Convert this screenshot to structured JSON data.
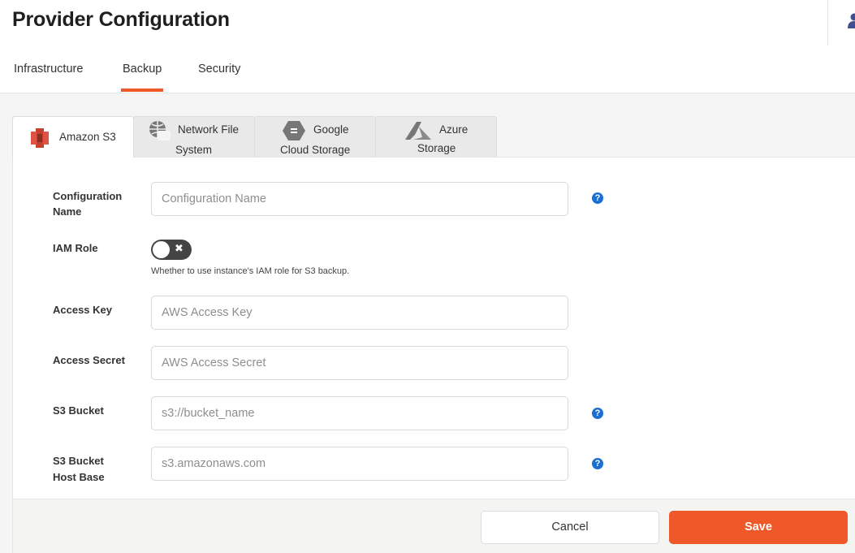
{
  "header": {
    "title": "Provider Configuration",
    "user_icon": "user-icon"
  },
  "top_tabs": [
    {
      "label": "Infrastructure",
      "active": false
    },
    {
      "label": "Backup",
      "active": true
    },
    {
      "label": "Security",
      "active": false
    }
  ],
  "provider_tabs": [
    {
      "label_line1": "Amazon S3",
      "label_line2": "",
      "icon": "amazon-s3-icon",
      "active": true
    },
    {
      "label_line1": "Network File",
      "label_line2": "System",
      "icon": "globe-icon",
      "active": false
    },
    {
      "label_line1": "Google",
      "label_line2": "Cloud Storage",
      "icon": "google-cloud-storage-icon",
      "active": false
    },
    {
      "label_line1": "Azure",
      "label_line2": "Storage",
      "icon": "azure-icon",
      "active": false
    }
  ],
  "form": {
    "config_name": {
      "label_line1": "Configuration",
      "label_line2": "Name",
      "placeholder": "Configuration Name",
      "value": ""
    },
    "iam_role": {
      "label": "IAM Role",
      "enabled": false,
      "off_symbol": "✖",
      "hint": "Whether to use instance's IAM role for S3 backup."
    },
    "access_key": {
      "label": "Access Key",
      "placeholder": "AWS Access Key",
      "value": ""
    },
    "access_secret": {
      "label": "Access Secret",
      "placeholder": "AWS Access Secret",
      "value": ""
    },
    "s3_bucket": {
      "label": "S3 Bucket",
      "placeholder": "s3://bucket_name",
      "value": ""
    },
    "host_base": {
      "label_line1": "S3 Bucket",
      "label_line2": "Host Base",
      "placeholder": "s3.amazonaws.com",
      "value": ""
    },
    "help_symbol": "?"
  },
  "footer": {
    "cancel_label": "Cancel",
    "save_label": "Save"
  },
  "colors": {
    "accent": "#ef5828",
    "help_icon": "#1a6fd1",
    "user_icon": "#3f4f8f"
  }
}
